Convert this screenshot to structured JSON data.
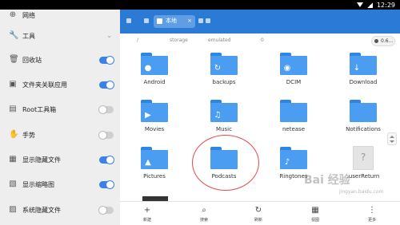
{
  "status_bar": {
    "time": "12:29"
  },
  "sidebar": {
    "items": [
      {
        "label": "网络",
        "icon": "network-icon",
        "control": "none"
      },
      {
        "label": "工具",
        "icon": "wrench-icon",
        "control": "chevron"
      },
      {
        "label": "回收站",
        "icon": "trash-icon",
        "control": "toggle",
        "on": true
      },
      {
        "label": "文件夹关联应用",
        "icon": "folder-link-icon",
        "control": "toggle",
        "on": true
      },
      {
        "label": "Root工具箱",
        "icon": "root-toolbox-icon",
        "control": "toggle",
        "on": false
      },
      {
        "label": "手势",
        "icon": "hand-gesture-icon",
        "control": "toggle",
        "on": false
      },
      {
        "label": "显示隐藏文件",
        "icon": "hidden-files-icon",
        "control": "toggle",
        "on": true
      },
      {
        "label": "显示缩略图",
        "icon": "thumbnail-icon",
        "control": "toggle",
        "on": true
      },
      {
        "label": "系统隐藏文件",
        "icon": "system-hidden-icon",
        "control": "toggle",
        "on": false
      }
    ]
  },
  "topbar": {
    "tab_label": "本地",
    "tab_close": "×"
  },
  "path": {
    "segments": [
      "/",
      "storage",
      "emulated",
      "0"
    ],
    "zoom_label": "0.6..."
  },
  "files": [
    {
      "name": "Android",
      "kind": "folder",
      "glyph": "android-icon"
    },
    {
      "name": "backups",
      "kind": "folder",
      "glyph": "backup-icon"
    },
    {
      "name": "DCIM",
      "kind": "folder",
      "glyph": "camera-icon"
    },
    {
      "name": "Download",
      "kind": "folder",
      "glyph": "download-icon"
    },
    {
      "name": "Movies",
      "kind": "folder",
      "glyph": "movie-icon"
    },
    {
      "name": "Music",
      "kind": "folder",
      "glyph": "music-icon"
    },
    {
      "name": "netease",
      "kind": "folder",
      "glyph": ""
    },
    {
      "name": "Notifications",
      "kind": "folder",
      "glyph": ""
    },
    {
      "name": "Pictures",
      "kind": "folder",
      "glyph": "picture-icon"
    },
    {
      "name": "Podcasts",
      "kind": "folder",
      "glyph": ""
    },
    {
      "name": "Ringtones",
      "kind": "folder",
      "glyph": "ringtone-icon"
    },
    {
      "name": ".userReturn",
      "kind": "file",
      "glyph": "unknown-file-icon"
    }
  ],
  "bottom_bar": {
    "new": "新建",
    "search": "搜索",
    "refresh": "刷新",
    "view": "视图",
    "more": "更多"
  },
  "watermark": {
    "title": "Bai 经验",
    "sub": "jingyan.baidu.com"
  },
  "colors": {
    "accent": "#2b7bd6",
    "folder": "#4a9df0",
    "toggle_on": "#3a82e6",
    "annotation": "#e64b4b"
  }
}
